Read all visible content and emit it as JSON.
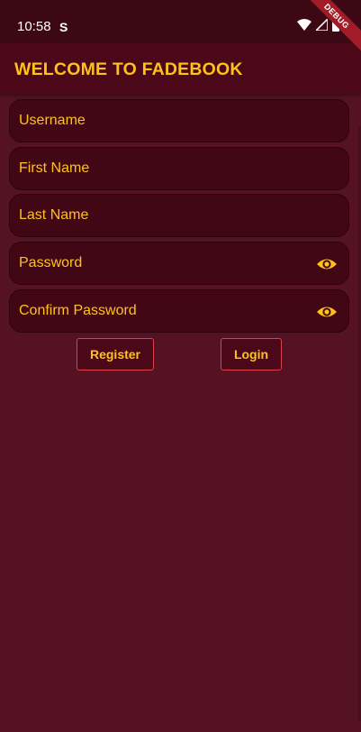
{
  "status_bar": {
    "time": "10:58",
    "sim_icon": "S",
    "icons": [
      "wifi-icon",
      "signal-icon",
      "battery-icon"
    ],
    "debug_banner": "DEBUG"
  },
  "app_bar": {
    "title": "WELCOME TO FADEBOOK"
  },
  "form": {
    "username_label": "Username",
    "first_name_label": "First Name",
    "last_name_label": "Last Name",
    "password_label": "Password",
    "confirm_password_label": "Confirm Password"
  },
  "actions": {
    "register_label": "Register",
    "login_label": "Login"
  },
  "colors": {
    "background": "#551223",
    "app_bar": "#4a0818",
    "accent_text": "#ffc21a",
    "button_border": "#e0404a"
  }
}
